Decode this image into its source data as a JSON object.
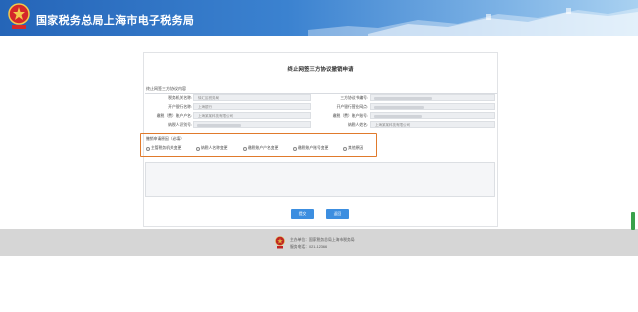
{
  "header": {
    "site_title": "国家税务总局上海市电子税务局",
    "brand_colors": {
      "banner_start": "#2565b8",
      "banner_end": "#a9d1f1",
      "accent": "#e07a2c",
      "button": "#3c8ee0"
    }
  },
  "form": {
    "title": "终止网签三方协议撤销申请",
    "section_title": "终止网签三方协议内容",
    "left_fields": [
      {
        "label": "税务机关名称:",
        "value": "徐汇区税务局"
      },
      {
        "label": "开户银行名称:",
        "value": "上海银行"
      },
      {
        "label": "缴税（费）账户户名:",
        "value": "上海某某科技有限公司"
      },
      {
        "label": "纳税人识别号:",
        "value": ""
      }
    ],
    "right_fields": [
      {
        "label": "三方协议书编号:",
        "value": ""
      },
      {
        "label": "开户银行营业网点:",
        "value": ""
      },
      {
        "label": "缴税（费）账户账号:",
        "value": ""
      },
      {
        "label": "纳税人姓名:",
        "value": "上海某某科技有限公司"
      }
    ],
    "reason": {
      "title": "撤销申请原因（必填）",
      "options": [
        {
          "label": "主管税务机关变更",
          "icon": "radio-icon"
        },
        {
          "label": "纳税人名称变更",
          "icon": "radio-icon"
        },
        {
          "label": "缴税账户户名变更",
          "icon": "radio-icon"
        },
        {
          "label": "缴税账户账号变更",
          "icon": "radio-icon"
        },
        {
          "label": "其他原因",
          "icon": "radio-icon"
        }
      ]
    },
    "buttons": {
      "submit": "提交",
      "return": "返回"
    }
  },
  "footer": {
    "sponsor": "主办单位：国家税务总局上海市税务局",
    "phone": "服务电话：021-12366"
  }
}
